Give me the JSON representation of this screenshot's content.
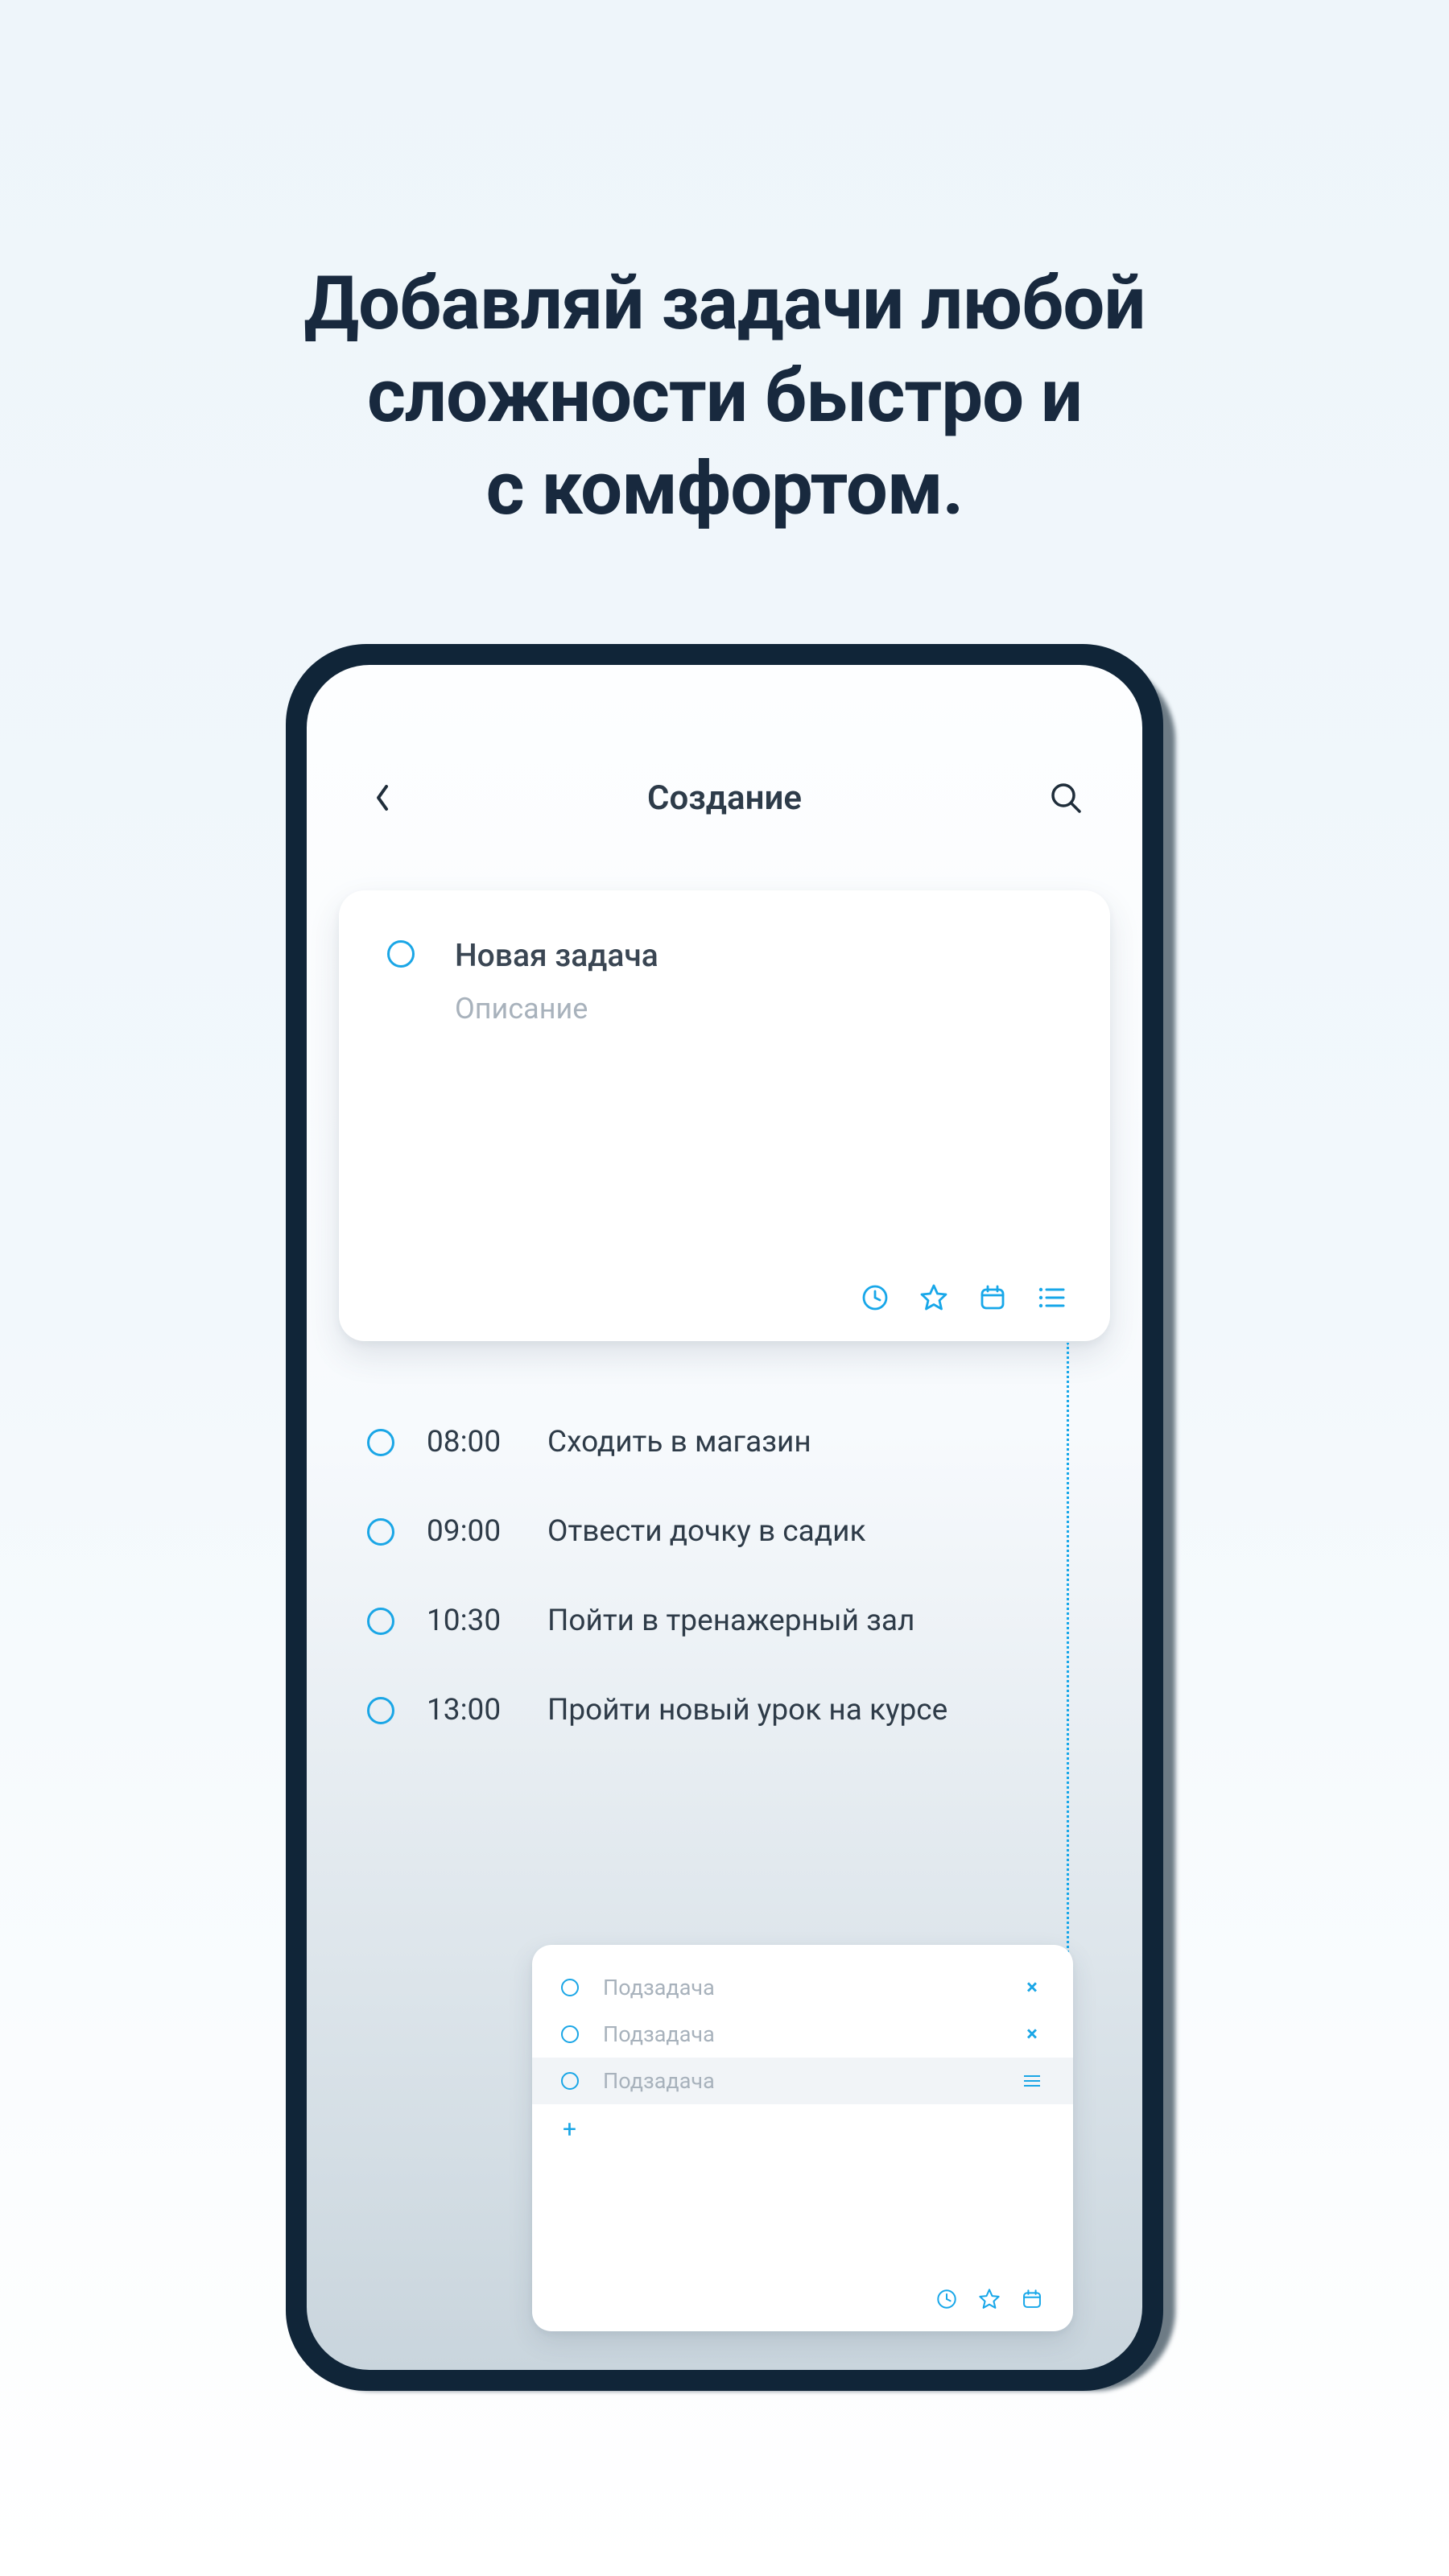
{
  "hero": {
    "line1": "Добавляй задачи любой",
    "line2": "сложности быстро и",
    "line3": "с комфортом."
  },
  "topbar": {
    "title": "Создание"
  },
  "create": {
    "title": "Новая задача",
    "description": "Описание"
  },
  "tasks": [
    {
      "time": "08:00",
      "title": "Сходить в магазин"
    },
    {
      "time": "09:00",
      "title": "Отвести дочку в садик"
    },
    {
      "time": "10:30",
      "title": "Пойти в тренажерный зал"
    },
    {
      "time": "13:00",
      "title": "Пройти новый урок на курсе"
    }
  ],
  "subtasks": [
    {
      "label": "Подзадача",
      "trailing": "close"
    },
    {
      "label": "Подзадача",
      "trailing": "close"
    },
    {
      "label": "Подзадача",
      "trailing": "drag"
    }
  ],
  "colors": {
    "accent": "#17a7e9",
    "text": "#2e3b48"
  }
}
